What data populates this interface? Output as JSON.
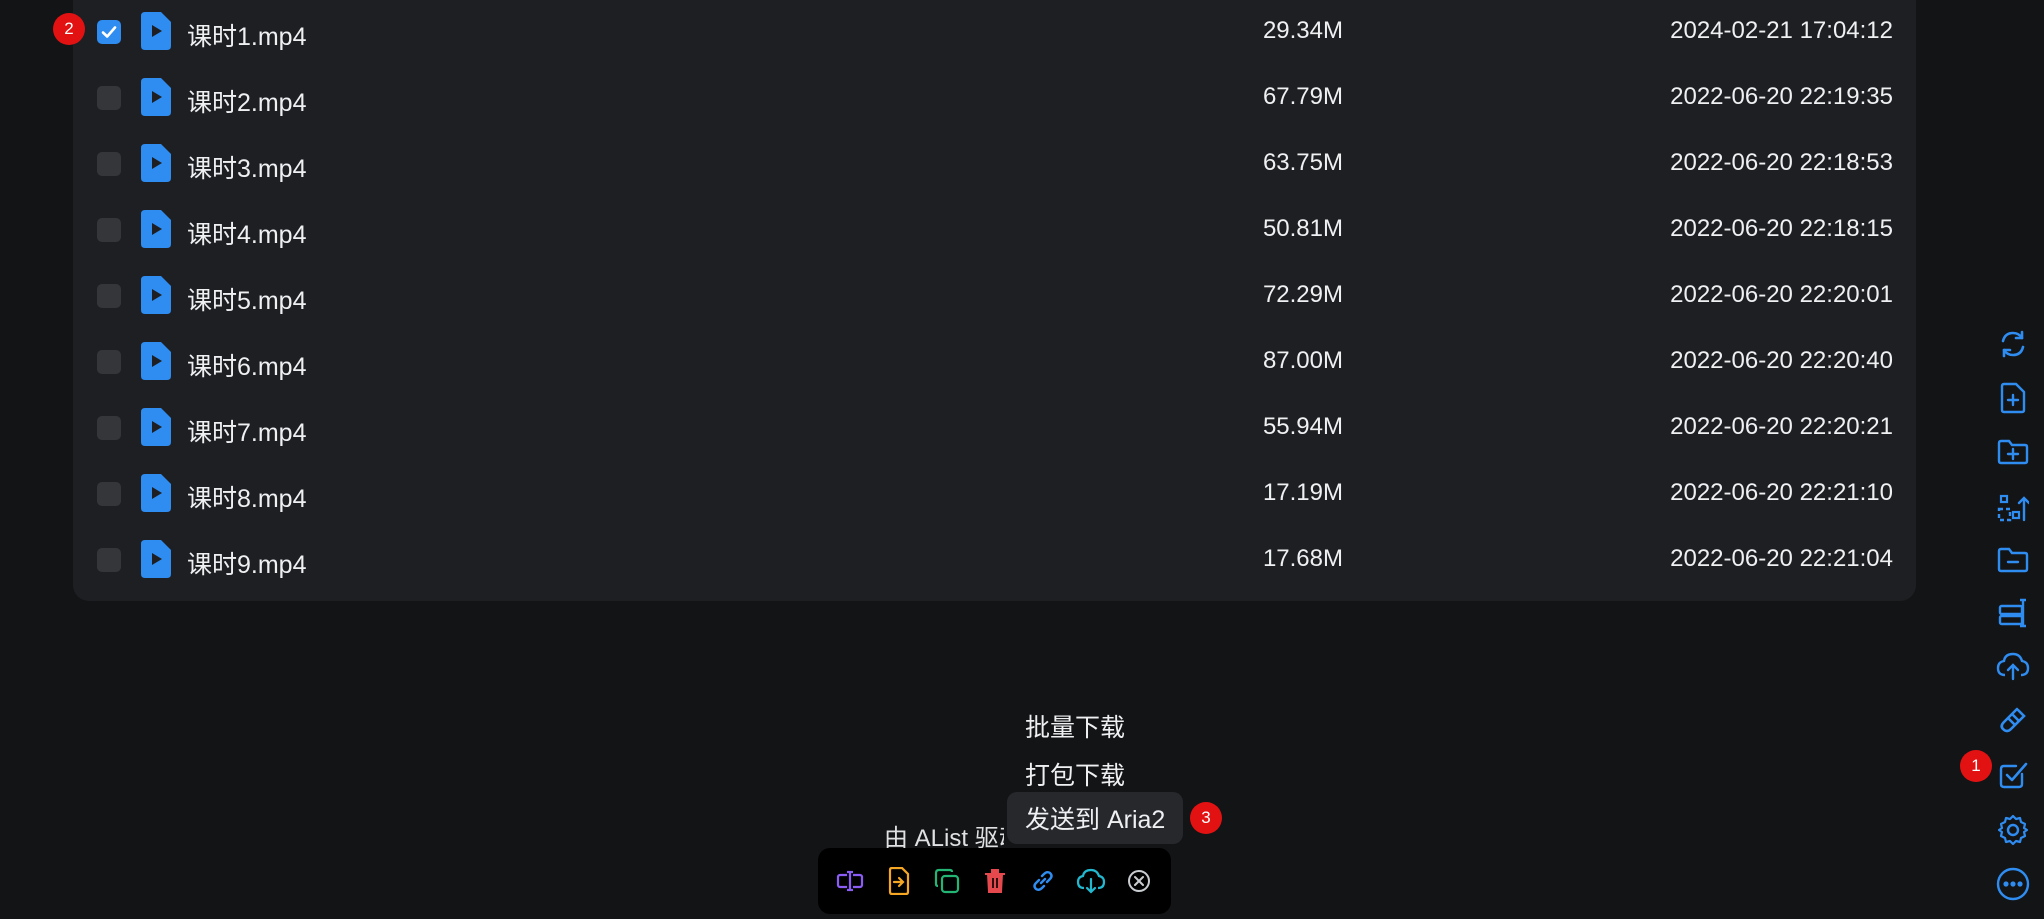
{
  "files": [
    {
      "name": "课时1.mp4",
      "size": "29.34M",
      "modified": "2024-02-21 17:04:12",
      "checked": true
    },
    {
      "name": "课时2.mp4",
      "size": "67.79M",
      "modified": "2022-06-20 22:19:35",
      "checked": false
    },
    {
      "name": "课时3.mp4",
      "size": "63.75M",
      "modified": "2022-06-20 22:18:53",
      "checked": false
    },
    {
      "name": "课时4.mp4",
      "size": "50.81M",
      "modified": "2022-06-20 22:18:15",
      "checked": false
    },
    {
      "name": "课时5.mp4",
      "size": "72.29M",
      "modified": "2022-06-20 22:20:01",
      "checked": false
    },
    {
      "name": "课时6.mp4",
      "size": "87.00M",
      "modified": "2022-06-20 22:20:40",
      "checked": false
    },
    {
      "name": "课时7.mp4",
      "size": "55.94M",
      "modified": "2022-06-20 22:20:21",
      "checked": false
    },
    {
      "name": "课时8.mp4",
      "size": "17.19M",
      "modified": "2022-06-20 22:21:10",
      "checked": false
    },
    {
      "name": "课时9.mp4",
      "size": "17.68M",
      "modified": "2022-06-20 22:21:04",
      "checked": false
    }
  ],
  "markers": {
    "one": "1",
    "two": "2",
    "three": "3"
  },
  "download_menu": {
    "batch_download": "批量下载",
    "package_download": "打包下载",
    "send_to_aria2": "发送到 Aria2"
  },
  "footer": {
    "powered_by": "由 AList 驱动"
  },
  "toolbar_icons": [
    "rename-icon",
    "move-icon",
    "copy-icon",
    "delete-icon",
    "copy-link-icon",
    "download-icon",
    "close-icon"
  ],
  "side_icons": [
    "refresh-icon",
    "new-file-icon",
    "new-folder-icon",
    "recursive-move-icon",
    "remove-empty-folder-icon",
    "batch-rename-icon",
    "upload-icon",
    "offline-download-icon",
    "toggle-checkbox-icon",
    "settings-icon",
    "more-icon"
  ],
  "colors": {
    "accent": "#2f8cf0",
    "marker": "#e31212",
    "rename": "#8b5cf6",
    "move": "#f5a623",
    "copy": "#22b573",
    "delete": "#e5484d",
    "link": "#2f8cf0",
    "download": "#22b8cf",
    "close": "#c9ccd1"
  }
}
